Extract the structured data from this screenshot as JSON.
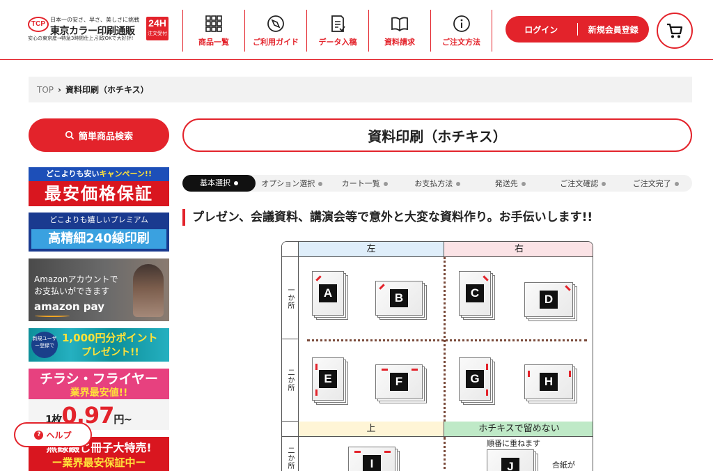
{
  "header": {
    "logo": {
      "mark": "TCP",
      "tagline": "日本一の安さ、早さ、美しさに挑戦",
      "name": "東京カラー印刷通販",
      "sub": "安心の東京産→特急3時間仕上,引取OKで大好評!",
      "badge_big": "24H",
      "badge_small": "注文受付"
    },
    "nav": [
      {
        "label": "商品一覧",
        "icon": "grid-icon"
      },
      {
        "label": "ご利用ガイド",
        "icon": "compass-icon"
      },
      {
        "label": "データ入稿",
        "icon": "document-icon"
      },
      {
        "label": "資料請求",
        "icon": "book-icon"
      },
      {
        "label": "ご注文方法",
        "icon": "info-icon"
      }
    ],
    "login_label": "ログイン",
    "register_label": "新規会員登録"
  },
  "breadcrumb": {
    "home": "TOP",
    "separator": "›",
    "current": "資料印刷（ホチキス）"
  },
  "sidebar": {
    "search_label": "簡単商品検索",
    "banners": {
      "b1": {
        "line1a": "どこよりも安い",
        "line1b": "キャンペーン!!",
        "line2": "最安価格保証"
      },
      "b2": {
        "line1": "どこよりも嬉しいプレミアム",
        "line2": "高精細240線印刷"
      },
      "b3": {
        "line1": "Amazonアカウントで",
        "line2": "お支払いができます",
        "line3": "amazon pay"
      },
      "b4": {
        "badge": "新規ユーザー登録で",
        "line1": "1,000円分ポイント",
        "line2": "プレゼント!!"
      },
      "b5": {
        "line1": "チラシ・フライヤー",
        "line2": "業界最安値!!",
        "line3a": "1枚",
        "line3b": "0.97",
        "line3c": "円~"
      },
      "b6": {
        "line1": "無線綴じ冊子大特売!",
        "line2": "ー業界最安保証中ー"
      }
    },
    "help_label": "ヘルプ"
  },
  "main": {
    "title": "資料印刷（ホチキス）",
    "steps": [
      {
        "label": "基本選択",
        "active": true
      },
      {
        "label": "オプション選択",
        "active": false
      },
      {
        "label": "カート一覧",
        "active": false
      },
      {
        "label": "お支払方法",
        "active": false
      },
      {
        "label": "発送先",
        "active": false
      },
      {
        "label": "ご注文確認",
        "active": false
      },
      {
        "label": "ご注文完了",
        "active": false
      }
    ],
    "heading": "プレゼン、会議資料、講演会等で意外と大変な資料作り。お手伝いします!!",
    "table": {
      "col_left": "左",
      "col_right": "右",
      "col_top": "上",
      "col_none": "ホチキスで留めない",
      "row1": "一か所",
      "row2": "二か所",
      "row3": "二か所",
      "letters": [
        "A",
        "B",
        "C",
        "D",
        "E",
        "F",
        "G",
        "H",
        "I",
        "J"
      ],
      "note_order": "順番に重ねます",
      "note_cover": "合紙が"
    },
    "colors": {
      "accent": "#e3232b",
      "left_header": "#dfeefa",
      "right_header": "#fbe3e6",
      "top_header": "#fff5d6",
      "none_header": "#bfe9c7"
    }
  }
}
